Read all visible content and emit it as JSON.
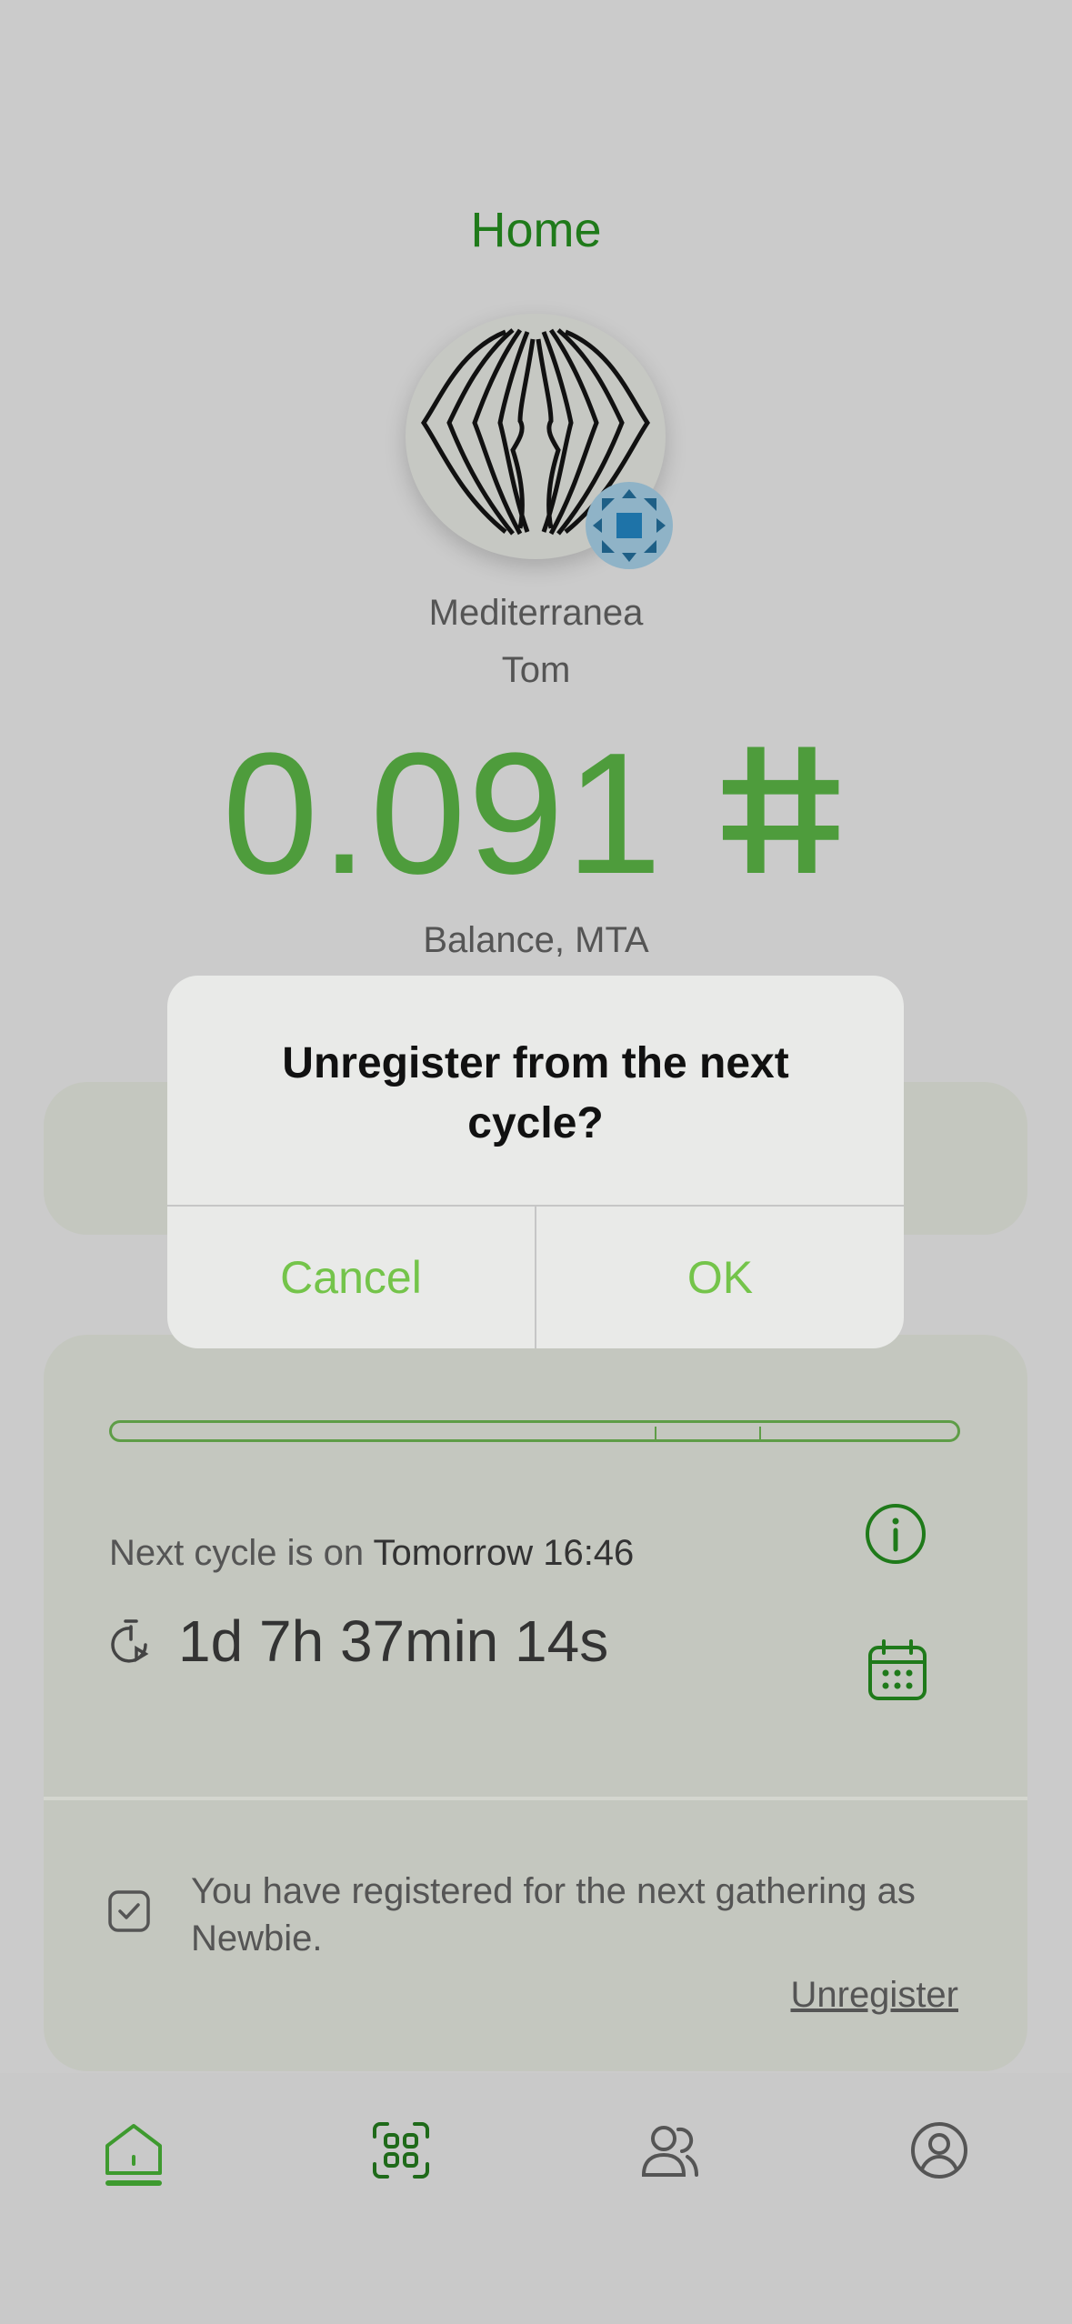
{
  "header": {
    "title": "Home"
  },
  "profile": {
    "community": "Mediterranea",
    "username": "Tom"
  },
  "balance": {
    "amount": "0.091",
    "currency_symbol": "ⵌ",
    "label": "Balance, MTA"
  },
  "cycle": {
    "next_prefix": "Next cycle is on",
    "next_time": "Tomorrow 16:46",
    "countdown": "1d 7h 37min 14s"
  },
  "registration": {
    "message": "You have registered for the next gathering as Newbie.",
    "unregister_label": "Unregister"
  },
  "dialog": {
    "title": "Unregister from the next cycle?",
    "cancel_label": "Cancel",
    "ok_label": "OK"
  },
  "tabbar": {
    "items": [
      {
        "icon": "home-icon",
        "active": true
      },
      {
        "icon": "scan-icon",
        "active": false
      },
      {
        "icon": "contacts-icon",
        "active": false
      },
      {
        "icon": "profile-icon",
        "active": false
      }
    ]
  },
  "colors": {
    "accent_green": "#1f7a1a",
    "button_green": "#74c44a",
    "balance_green": "#4e9c3c"
  }
}
